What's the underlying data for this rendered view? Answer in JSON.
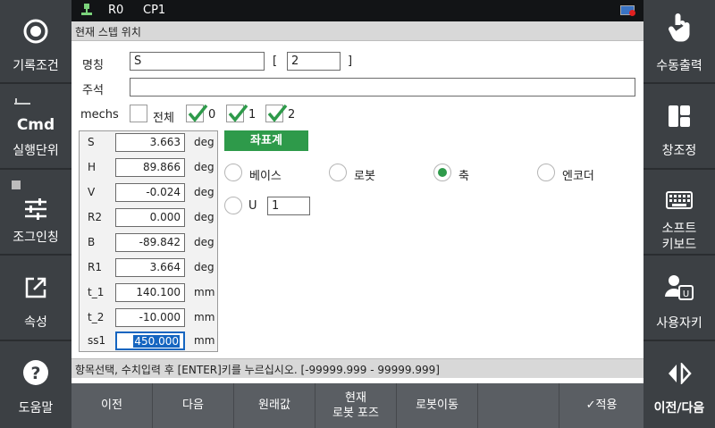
{
  "left_panel": [
    {
      "label": "기록조건",
      "icon": "record-circle-icon"
    },
    {
      "label": "실행단위",
      "icon": "cmd-icon",
      "icon_text": "Cmd"
    },
    {
      "label": "조그인칭",
      "icon": "sliders-icon"
    },
    {
      "label": "속성",
      "icon": "external-link-icon"
    },
    {
      "label": "도움말",
      "icon": "help-icon",
      "icon_text": "?"
    }
  ],
  "right_panel": [
    {
      "label": "수동출력",
      "icon": "touch-hand-icon"
    },
    {
      "label": "창조정",
      "icon": "window-layout-icon"
    },
    {
      "label1": "소프트",
      "label2": "키보드",
      "icon": "keyboard-icon"
    },
    {
      "label": "사용자키",
      "icon": "user-key-icon"
    },
    {
      "label": "이전/다음",
      "icon": "prev-next-icon"
    }
  ],
  "topbar": {
    "r": "R0",
    "cp": "CP1"
  },
  "title": "현재 스텝 위치",
  "form": {
    "name_label": "명칭",
    "name_value": "S",
    "bracket_open": "[",
    "bracket_value": "2",
    "bracket_close": "]",
    "comment_label": "주석",
    "comment_value": "",
    "mechs_label": "mechs",
    "mechs_all": "전체",
    "mechs": [
      "0",
      "1",
      "2"
    ]
  },
  "axes": [
    {
      "name": "S",
      "value": "3.663",
      "unit": "deg"
    },
    {
      "name": "H",
      "value": "89.866",
      "unit": "deg"
    },
    {
      "name": "V",
      "value": "-0.024",
      "unit": "deg"
    },
    {
      "name": "R2",
      "value": "0.000",
      "unit": "deg"
    },
    {
      "name": "B",
      "value": "-89.842",
      "unit": "deg"
    },
    {
      "name": "R1",
      "value": "3.664",
      "unit": "deg"
    },
    {
      "name": "t_1",
      "value": "140.100",
      "unit": "mm"
    },
    {
      "name": "t_2",
      "value": "-10.000",
      "unit": "mm"
    },
    {
      "name": "ss1",
      "value": "450.000",
      "unit": "mm"
    }
  ],
  "coord": {
    "button": "좌표계",
    "options": [
      "베이스",
      "로봇",
      "축",
      "엔코더"
    ],
    "selected": "축",
    "u_label": "U",
    "u_value": "1"
  },
  "status": "항목선택, 수치입력 후 [ENTER]키를 누르십시오. [-99999.999 - 99999.999]",
  "bottom": {
    "prev": "이전",
    "next": "다음",
    "original": "원래값",
    "current_pose_1": "현재",
    "current_pose_2": "로봇 포즈",
    "robot_move": "로봇이동",
    "apply": "적용"
  },
  "colors": {
    "accent": "#2e9a4a",
    "panel": "#3c4044",
    "selected_field": "#1565c0"
  }
}
